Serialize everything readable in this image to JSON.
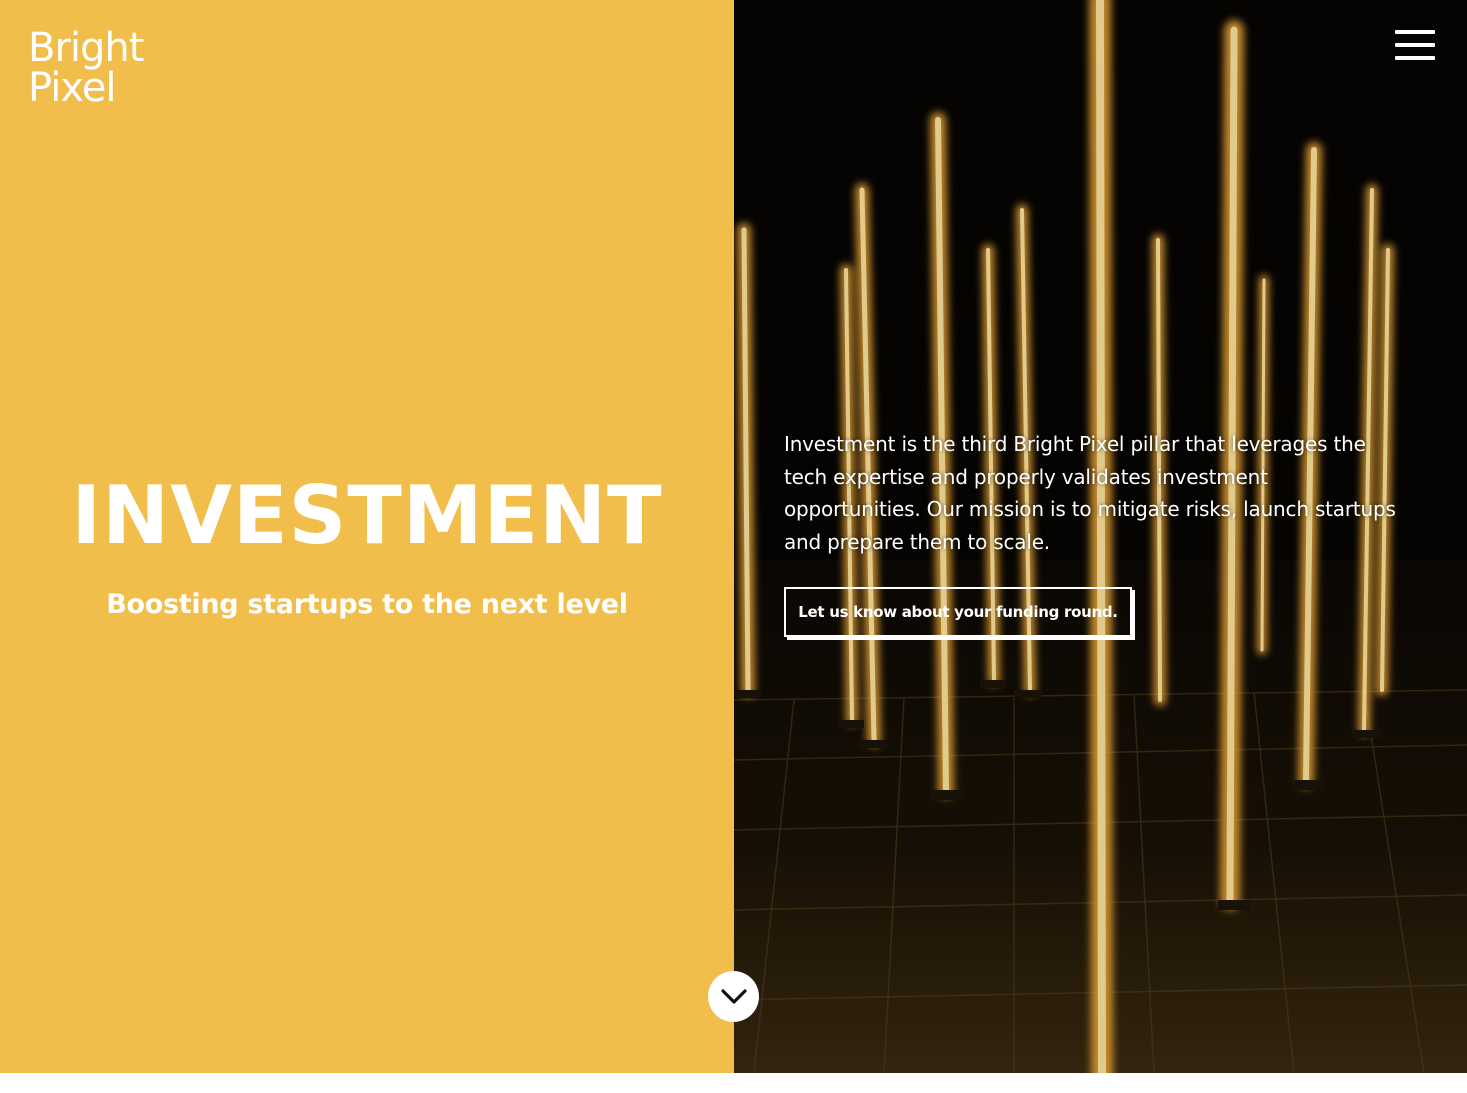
{
  "brand": {
    "line1": "Bright",
    "line2": "Pixel"
  },
  "hero": {
    "title": "INVESTMENT",
    "subtitle": "Boosting startups to the next level",
    "description": "Investment is the third Bright Pixel pillar that leverages the tech expertise and properly validates investment opportunities. Our mission is to mitigate risks, launch startups and prepare them to scale.",
    "cta_label": "Let us know about your funding round.",
    "background_image": "glowing-light-poles-photo"
  },
  "nav": {
    "menu_icon": "hamburger-menu-icon"
  },
  "scroll": {
    "icon": "chevron-down-icon"
  },
  "colors": {
    "accent": "#f1be4b",
    "text": "#ffffff",
    "photo_dark": "#0b0805",
    "glow": "#ffb43a"
  }
}
